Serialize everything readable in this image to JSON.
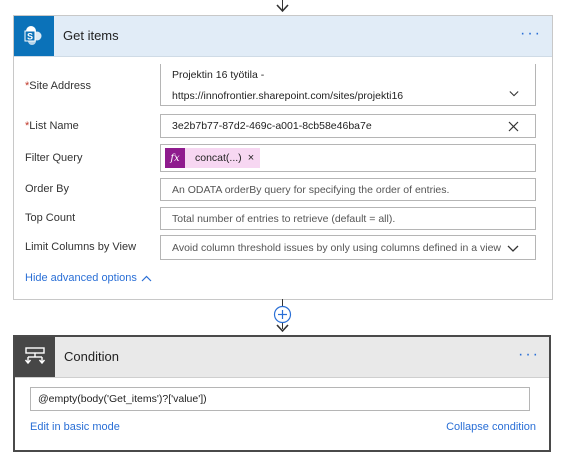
{
  "get_items": {
    "title": "Get items",
    "menu_label": "···",
    "fields": {
      "site_address": {
        "label": "Site Address",
        "required_mark": "*",
        "value_line1": "Projektin 16 työtila -",
        "value_line2": "https://innofrontier.sharepoint.com/sites/projekti16"
      },
      "list_name": {
        "label": "List Name",
        "required_mark": "*",
        "value": "3e2b7b77-87d2-469c-a001-8cb58e46ba7e"
      },
      "filter_query": {
        "label": "Filter Query",
        "token_icon": "fx",
        "token_text": "concat(...)",
        "token_remove": "×"
      },
      "order_by": {
        "label": "Order By",
        "placeholder": "An ODATA orderBy query for specifying the order of entries."
      },
      "top_count": {
        "label": "Top Count",
        "placeholder": "Total number of entries to retrieve (default = all)."
      },
      "limit_columns": {
        "label": "Limit Columns by View",
        "placeholder": "Avoid column threshold issues by only using columns defined in a view"
      }
    },
    "hide_advanced": "Hide advanced options"
  },
  "condition": {
    "title": "Condition",
    "menu_label": "···",
    "expression": "@empty(body('Get_items')?['value'])",
    "edit_basic": "Edit in basic mode",
    "collapse": "Collapse condition"
  },
  "colors": {
    "sharepoint_blue": "#0b72b9",
    "header_blue": "#e1ecf7",
    "link_blue": "#2a6fd6",
    "fx_purple": "#8f1b8e",
    "token_pink": "#f7d7f2",
    "required_red": "#c0392b"
  },
  "icons": [
    "arrow-down-icon",
    "sharepoint-icon",
    "chevron-down-icon",
    "close-icon",
    "fx-icon",
    "chevron-up-icon",
    "add-step-icon",
    "condition-icon",
    "more-options-icon"
  ]
}
